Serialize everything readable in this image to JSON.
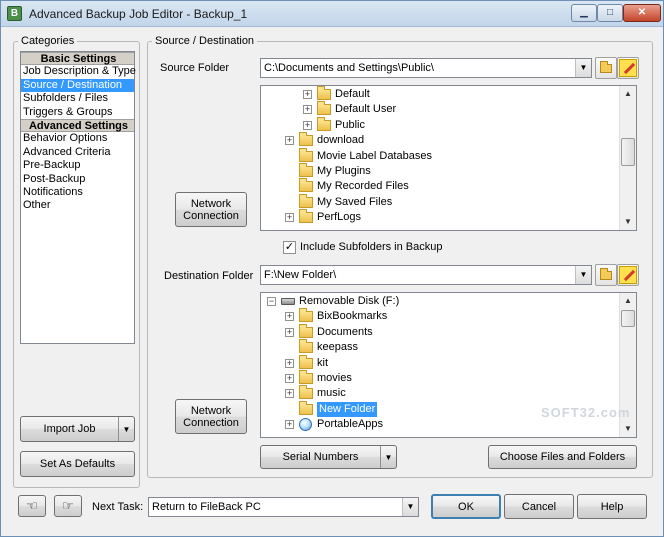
{
  "window": {
    "title": "Advanced Backup Job Editor - Backup_1",
    "app_icon_glyph": "B",
    "min_glyph": "▁",
    "max_glyph": "□",
    "close_glyph": "✕"
  },
  "categories": {
    "label": "Categories",
    "items": [
      {
        "label": "Basic Settings",
        "kind": "header"
      },
      {
        "label": "Job Description & Type",
        "kind": "item"
      },
      {
        "label": "Source / Destination",
        "kind": "selected"
      },
      {
        "label": "Subfolders / Files",
        "kind": "item"
      },
      {
        "label": "Triggers & Groups",
        "kind": "item"
      },
      {
        "label": "Advanced Settings",
        "kind": "header"
      },
      {
        "label": "Behavior Options",
        "kind": "item"
      },
      {
        "label": "Advanced Criteria",
        "kind": "item"
      },
      {
        "label": "Pre-Backup",
        "kind": "item"
      },
      {
        "label": "Post-Backup",
        "kind": "item"
      },
      {
        "label": "Notifications",
        "kind": "item"
      },
      {
        "label": "Other",
        "kind": "item"
      }
    ]
  },
  "left_buttons": {
    "import_job": "Import Job",
    "set_defaults": "Set As Defaults"
  },
  "source_dest": {
    "group_label": "Source / Destination",
    "source_label": "Source Folder",
    "source_value": "C:\\Documents and Settings\\Public\\",
    "network_button": "Network Connection",
    "source_tree": [
      {
        "label": "Default",
        "exp": true,
        "icon": "folder"
      },
      {
        "label": "Default User",
        "exp": true,
        "icon": "folder"
      },
      {
        "label": "Public",
        "exp": true,
        "icon": "folder"
      },
      {
        "label": "download",
        "exp": true,
        "icon": "folder"
      },
      {
        "label": "Movie Label Databases",
        "exp": false,
        "icon": "folder"
      },
      {
        "label": "My Plugins",
        "exp": false,
        "icon": "folder"
      },
      {
        "label": "My Recorded Files",
        "exp": false,
        "icon": "folder"
      },
      {
        "label": "My Saved Files",
        "exp": false,
        "icon": "folder"
      },
      {
        "label": "PerfLogs",
        "exp": true,
        "icon": "folder"
      }
    ],
    "include_subfolders_label": "Include Subfolders in Backup",
    "include_subfolders_checked": true,
    "destination_label": "Destination Folder",
    "destination_value": "F:\\New Folder\\",
    "dest_tree": [
      {
        "label": "Removable Disk (F:)",
        "exp": "minus",
        "icon": "disk"
      },
      {
        "label": "BixBookmarks",
        "exp": true,
        "icon": "folder"
      },
      {
        "label": "Documents",
        "exp": true,
        "icon": "folder"
      },
      {
        "label": "keepass",
        "exp": false,
        "icon": "folder"
      },
      {
        "label": "kit",
        "exp": true,
        "icon": "folder"
      },
      {
        "label": "movies",
        "exp": true,
        "icon": "folder"
      },
      {
        "label": "music",
        "exp": true,
        "icon": "folder"
      },
      {
        "label": "New Folder",
        "exp": false,
        "icon": "folder",
        "selected": true
      },
      {
        "label": "PortableApps",
        "exp": true,
        "icon": "globe"
      }
    ],
    "serial_numbers": "Serial Numbers",
    "choose_files": "Choose Files and Folders"
  },
  "bottom": {
    "next_task_label": "Next Task:",
    "next_task_value": "Return to FileBack PC",
    "ok": "OK",
    "cancel": "Cancel",
    "help": "Help"
  },
  "watermark": "SOFT32.com",
  "glyphs": {
    "dropdown": "▼",
    "scroll_up": "▲",
    "scroll_down": "▼",
    "check": "✓",
    "plus": "+",
    "minus": "−"
  }
}
